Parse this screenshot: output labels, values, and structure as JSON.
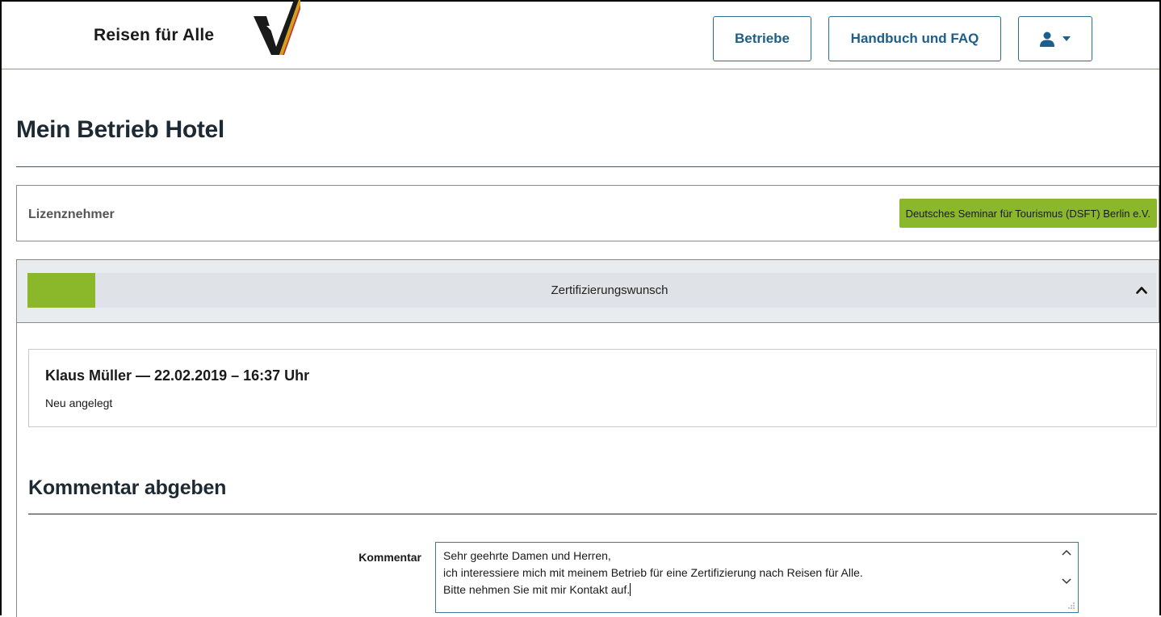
{
  "header": {
    "logo_text": "Reisen für Alle",
    "nav": {
      "betriebe_label": "Betriebe",
      "faq_label": "Handbuch und FAQ"
    },
    "user_menu_icon": "user-icon",
    "user_menu_caret_icon": "caret-down-icon"
  },
  "page": {
    "title": "Mein Betrieb Hotel"
  },
  "lizenz": {
    "label": "Lizenznehmer",
    "badge": "Deutsches Seminar für Tourismus (DSFT) Berlin e.V."
  },
  "accordion": {
    "title": "Zertifizierungswunsch",
    "toggle_icon": "chevron-up-icon",
    "status_color": "#8bb82b"
  },
  "entry": {
    "title": "Klaus Müller — 22.02.2019 – 16:37 Uhr",
    "subtitle": "Neu angelegt"
  },
  "comment": {
    "section_title": "Kommentar abgeben",
    "field_label": "Kommentar",
    "lines": [
      "Sehr geehrte Damen und Herren,",
      "ich interessiere mich mit meinem Betrieb für eine Zertifizierung nach Reisen für Alle.",
      "Bitte nehmen Sie mit mir Kontakt auf."
    ]
  },
  "colors": {
    "brand_blue": "#1d5f8a",
    "accent_green": "#8bb82b"
  }
}
